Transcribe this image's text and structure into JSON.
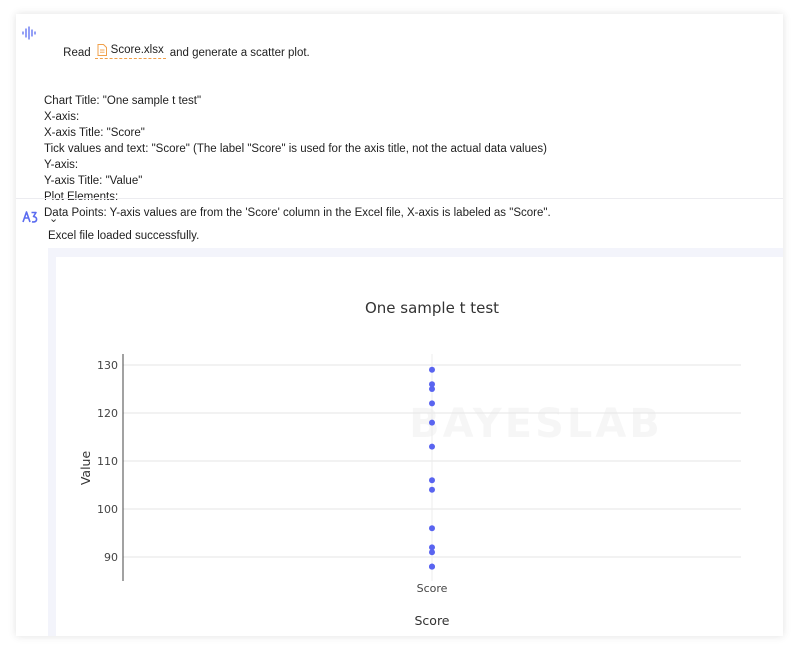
{
  "prompt": {
    "read_word": "Read",
    "file_name": "Score.xlsx",
    "rest": "and generate a scatter plot.",
    "lines": [
      "Chart Title: \"One sample t test\"",
      "X-axis:",
      "X-axis Title: \"Score\"",
      "Tick values and text: \"Score\" (The label \"Score\" is used for the axis title, not the actual data values)",
      "Y-axis:",
      "Y-axis Title: \"Value\"",
      "Plot Elements:",
      "Data Points: Y-axis values are from the 'Score' column in the Excel file, X-axis is labeled as \"Score\"."
    ]
  },
  "response": {
    "status": "Excel file loaded successfully."
  },
  "watermark": "BAYESLAB",
  "colors": {
    "point": "#5964f0",
    "accent": "#5b6cf0",
    "file_icon": "#f0a04b"
  },
  "chart_data": {
    "type": "scatter",
    "title": "One sample t test",
    "xlabel": "Score",
    "ylabel": "Value",
    "categories": [
      "Score"
    ],
    "x": [
      "Score",
      "Score",
      "Score",
      "Score",
      "Score",
      "Score",
      "Score",
      "Score",
      "Score",
      "Score",
      "Score",
      "Score",
      "Score"
    ],
    "y": [
      129,
      126,
      125,
      122,
      118,
      113,
      106,
      104,
      96,
      92,
      91,
      88,
      88
    ],
    "yticks": [
      90,
      100,
      110,
      120,
      130
    ],
    "ylim": [
      85,
      132
    ],
    "grid": true,
    "legend": "none"
  }
}
